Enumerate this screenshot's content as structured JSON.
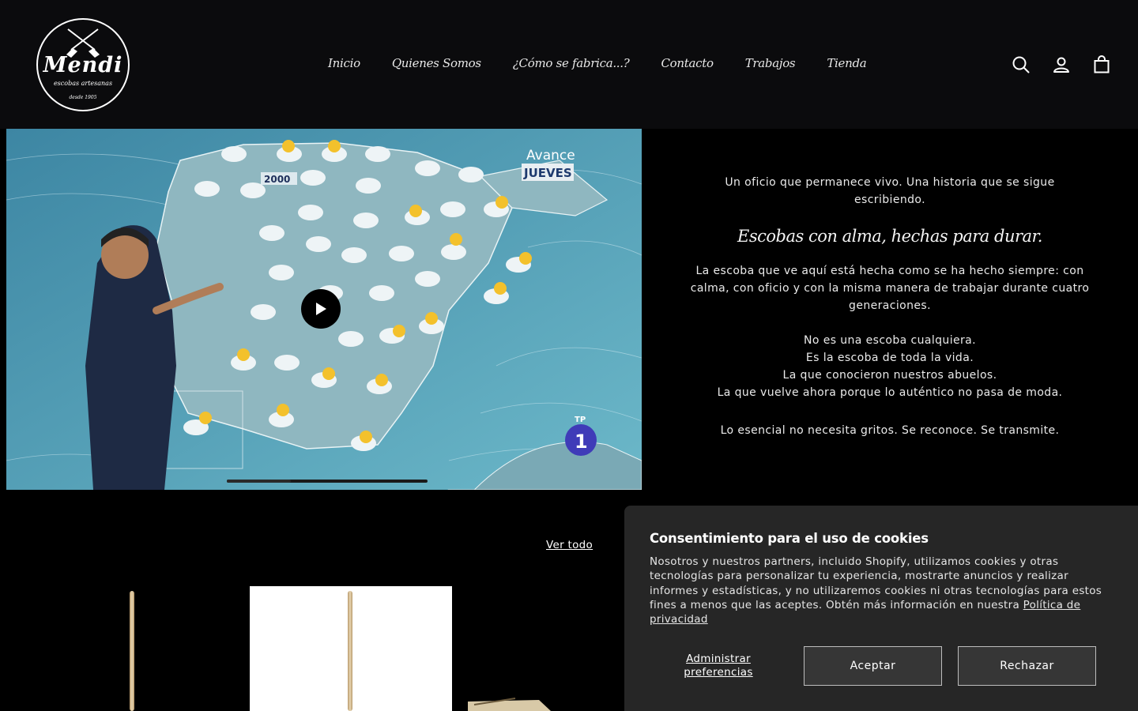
{
  "header": {
    "logo": {
      "word": "Mendi",
      "subtitle": "escobas artesanas",
      "since": "desde 1905"
    },
    "nav": [
      {
        "label": "Inicio"
      },
      {
        "label": "Quienes Somos"
      },
      {
        "label": "¿Cómo se fabrica...?"
      },
      {
        "label": "Contacto"
      },
      {
        "label": "Trabajos"
      },
      {
        "label": "Tienda"
      }
    ],
    "icons": [
      "search-icon",
      "account-icon",
      "cart-icon"
    ]
  },
  "video": {
    "overlay_top": "Avance",
    "overlay_day": "JUEVES",
    "badge_value": "2000",
    "channel": "1",
    "channel_tag": "TP",
    "progress": 0.32
  },
  "story": {
    "intro": "Un oficio que permanece vivo. Una historia que se sigue escribiendo.",
    "tagline": "Escobas con alma, hechas para durar.",
    "paragraph": "La escoba que ve aquí está hecha como se ha hecho siempre: con calma, con oficio y con la misma manera de trabajar durante cuatro generaciones.",
    "lines": [
      "No es una escoba cualquiera.",
      "Es la escoba de toda la vida.",
      "La que conocieron nuestros abuelos.",
      "La que vuelve ahora porque lo auténtico no pasa de moda."
    ],
    "closing": "Lo esencial no necesita gritos. Se reconoce. Se transmite."
  },
  "collection": {
    "view_all": "Ver todo"
  },
  "cookies": {
    "title": "Consentimiento para el uso de cookies",
    "message": "Nosotros y nuestros partners, incluido Shopify, utilizamos cookies y otras tecnologías para personalizar tu experiencia, mostrarte anuncios y realizar informes y estadísticas, y no utilizaremos cookies ni otras tecnologías para estos fines a menos que las aceptes. Obtén más información en nuestra",
    "privacy_link": "Política de privacidad",
    "manage": "Administrar preferencias",
    "accept": "Aceptar",
    "reject": "Rechazar"
  },
  "colors": {
    "header_bg": "#0b0b0d",
    "page_bg": "#000000",
    "cookie_bg": "#262626",
    "sea": "#5aa3b9",
    "land": "#8fb7c0"
  }
}
